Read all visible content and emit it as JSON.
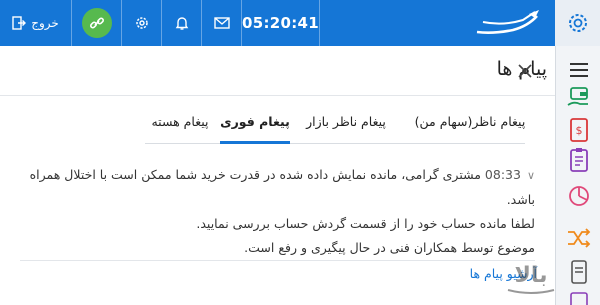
{
  "topbar": {
    "exit_label": "خروج",
    "clock": "05:20:41",
    "colors": {
      "bar": "#1576d6",
      "green": "#57b94e"
    }
  },
  "panel": {
    "title": "پیام ها",
    "tabs": [
      {
        "label": "پیغام ناظر(سهام من)",
        "active": false
      },
      {
        "label": "پیغام ناظر بازار",
        "active": false
      },
      {
        "label": "پیغام فوری",
        "active": true
      },
      {
        "label": "پیغام هسته",
        "active": false
      }
    ],
    "message": {
      "time": "08:33",
      "line1": "مشتری گرامی، مانده نمایش داده شده در قدرت خرید شما ممکن است با اختلال همراه باشد.",
      "line2": "لطفا مانده حساب خود را از قسمت گردش حساب بررسی نمایید.",
      "line3": "موضوع توسط همکاران فنی در حال پیگیری و رفع است."
    },
    "archive_link": "آرشیو پیام ها"
  },
  "icons": {
    "exit": "exit-icon",
    "link": "link-icon",
    "settings": "gear-icon",
    "notifications": "bell-icon",
    "mail": "mail-icon",
    "logo": "logo-icon",
    "close": "close-icon",
    "menu": "hamburger-icon"
  },
  "watermark": "بالاتر"
}
